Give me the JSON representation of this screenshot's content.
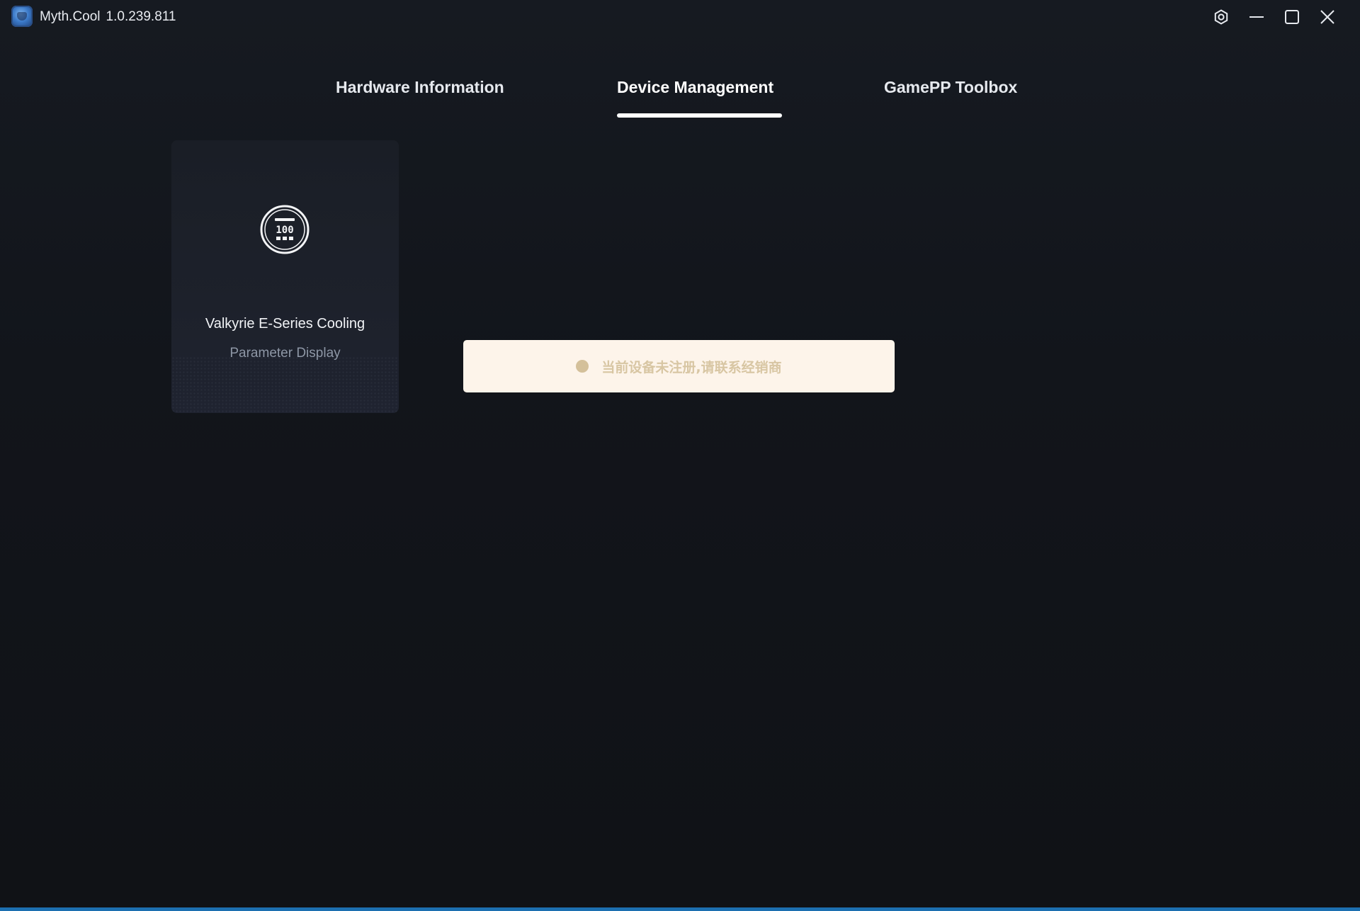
{
  "titlebar": {
    "app_name": "Myth.Cool",
    "version": "1.0.239.811",
    "controls": [
      "settings-icon",
      "minimize-icon",
      "maximize-icon",
      "close-icon"
    ]
  },
  "tabs": [
    {
      "label": "Hardware Information",
      "active": false
    },
    {
      "label": "Device Management",
      "active": true
    },
    {
      "label": "GamePP Toolbox",
      "active": false
    }
  ],
  "device_card": {
    "name": "Valkyrie E-Series Cooling",
    "subtitle": "Parameter Display",
    "icon": "display-panel-icon",
    "icon_value": "100"
  },
  "notice": {
    "text": "当前设备未注册,请联系经销商",
    "bg_color": "#fdf4ea",
    "text_color": "#d8c6a3"
  },
  "colors": {
    "background": "#111419",
    "accent_bar": "#1c6fb0"
  }
}
